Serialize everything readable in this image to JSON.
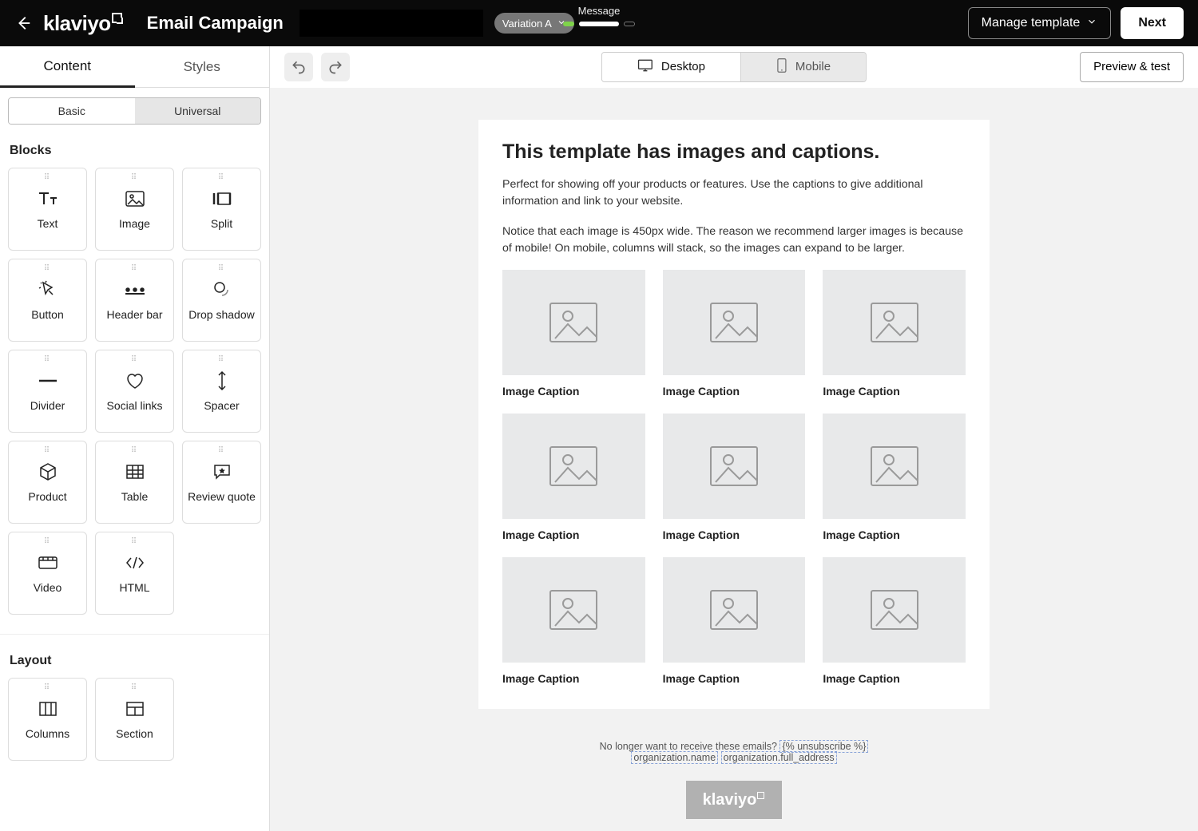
{
  "header": {
    "logo_text": "klaviyo",
    "campaign_title": "Email Campaign",
    "variation_label": "Variation A",
    "step_label": "Message",
    "manage_template_label": "Manage template",
    "next_label": "Next"
  },
  "toolbar": {
    "desktop_label": "Desktop",
    "mobile_label": "Mobile",
    "preview_label": "Preview & test"
  },
  "sidebar": {
    "tabs": {
      "content": "Content",
      "styles": "Styles"
    },
    "subtabs": {
      "basic": "Basic",
      "universal": "Universal"
    },
    "blocks_heading": "Blocks",
    "layout_heading": "Layout",
    "blocks": [
      {
        "label": "Text"
      },
      {
        "label": "Image"
      },
      {
        "label": "Split"
      },
      {
        "label": "Button"
      },
      {
        "label": "Header bar"
      },
      {
        "label": "Drop shadow"
      },
      {
        "label": "Divider"
      },
      {
        "label": "Social links"
      },
      {
        "label": "Spacer"
      },
      {
        "label": "Product"
      },
      {
        "label": "Table"
      },
      {
        "label": "Review quote"
      },
      {
        "label": "Video"
      },
      {
        "label": "HTML"
      }
    ],
    "layouts": [
      {
        "label": "Columns"
      },
      {
        "label": "Section"
      }
    ]
  },
  "email": {
    "heading": "This template has images and captions.",
    "para1": "Perfect for showing off your products or features. Use the captions to give additional information and link to your website.",
    "para2": "Notice that each image is 450px wide. The reason we recommend larger images is because of mobile! On mobile, columns will stack, so the images can expand to be larger.",
    "captions": [
      "Image Caption",
      "Image Caption",
      "Image Caption",
      "Image Caption",
      "Image Caption",
      "Image Caption",
      "Image Caption",
      "Image Caption",
      "Image Caption"
    ],
    "footer_q": "No longer want to receive these emails? ",
    "footer_unsub": "{% unsubscribe %}",
    "footer_org_name": "organization.name",
    "footer_org_addr": "organization.full_address",
    "footer_logo": "klaviyo"
  }
}
